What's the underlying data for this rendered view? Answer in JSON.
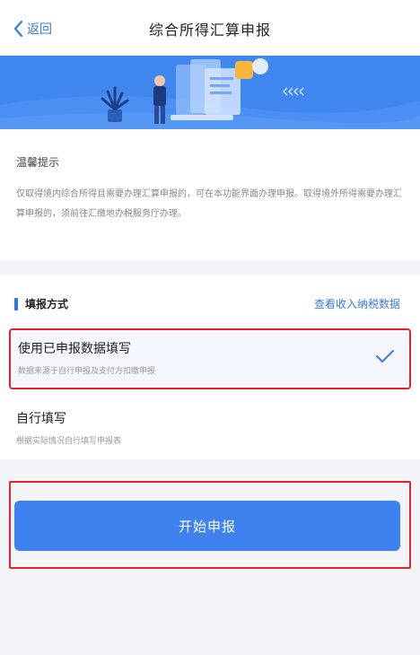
{
  "nav": {
    "back_label": "返回",
    "title": "综合所得汇算申报"
  },
  "tips": {
    "title": "温馨提示",
    "text": "仅取得境内综合所得且需要办理汇算申报的，可在本功能界面办理申报。取得境外所得需要办理汇算申报的，须前往汇缴地办税服务厅办理。"
  },
  "fill_method": {
    "title": "填报方式",
    "link_label": "查看收入纳税数据",
    "options": [
      {
        "title": "使用已申报数据填写",
        "subtitle": "数据来源于自行申报及支付方扣缴申报",
        "selected": true
      },
      {
        "title": "自行填写",
        "subtitle": "根据实际情况自行填写申报表",
        "selected": false
      }
    ]
  },
  "submit": {
    "label": "开始申报"
  },
  "colors": {
    "accent": "#3d82ee",
    "banner": "#3f86ef",
    "highlight_border": "#e5232b"
  }
}
